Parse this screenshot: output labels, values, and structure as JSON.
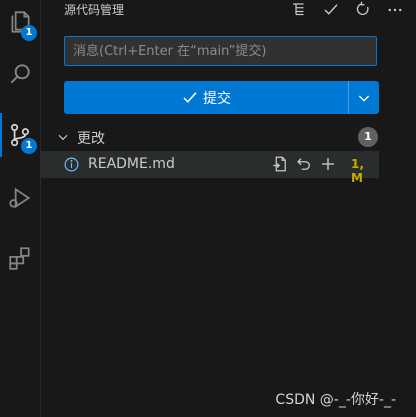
{
  "activity_bar": {
    "explorer_badge": "1",
    "scm_badge": "1",
    "accent_color": "#0078d4"
  },
  "scm": {
    "title": "源代码管理",
    "header_actions": [
      "view-as-tree-icon",
      "check-icon",
      "refresh-icon",
      "more-icon"
    ],
    "message_placeholder": "消息(Ctrl+Enter 在“main”提交)",
    "message_value": "",
    "commit_label": "提交",
    "changes_label": "更改",
    "changes_count": "1",
    "files": [
      {
        "name": "README.md",
        "status": "1, M",
        "status_color": "#cca700",
        "icon": "info-icon"
      }
    ]
  },
  "watermark": "CSDN @-_-你好-_-"
}
